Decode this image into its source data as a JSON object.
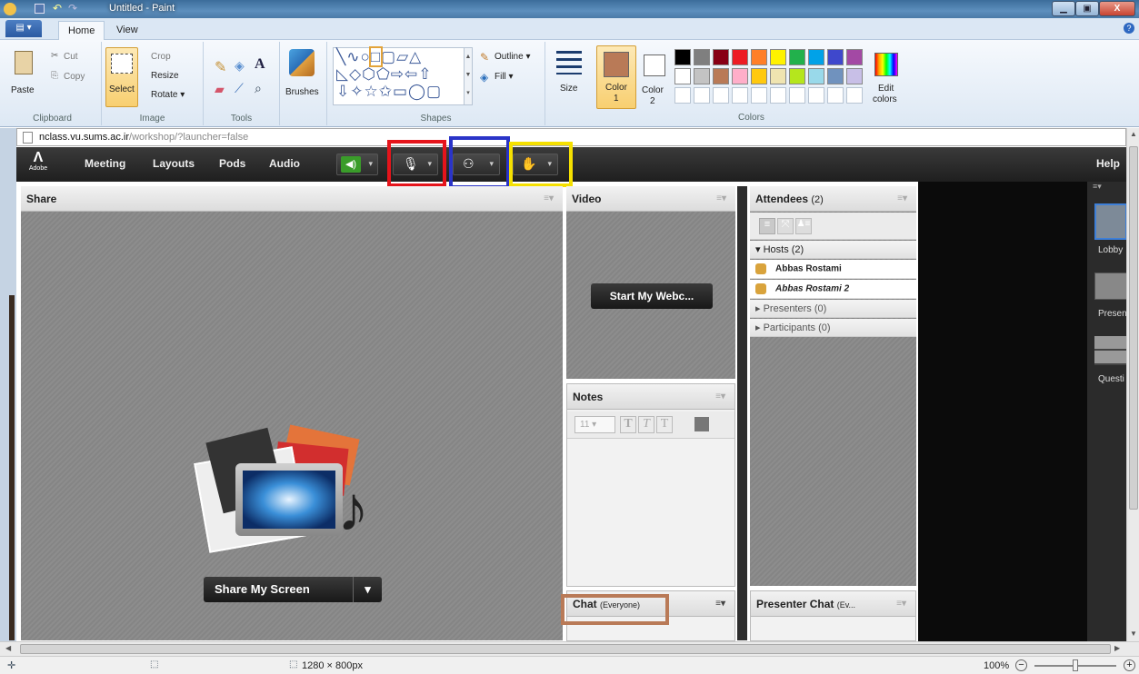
{
  "window": {
    "title": "Untitled - Paint"
  },
  "menu": {
    "home": "Home",
    "view": "View"
  },
  "ribbon": {
    "clipboard": {
      "paste": "Paste",
      "cut": "Cut",
      "copy": "Copy",
      "label": "Clipboard"
    },
    "image": {
      "select": "Select",
      "crop": "Crop",
      "resize": "Resize",
      "rotate": "Rotate ▾",
      "label": "Image"
    },
    "tools": {
      "label": "Tools"
    },
    "brushes": "Brushes",
    "shapes": {
      "outline": "Outline ▾",
      "fill": "Fill ▾",
      "label": "Shapes"
    },
    "size": "Size",
    "color1": "Color\n1",
    "color1_label": "Color",
    "color1_num": "1",
    "color2_label": "Color",
    "color2_num": "2",
    "edit_colors": "Edit",
    "edit_colors2": "colors",
    "colors_label": "Colors",
    "palette_row1": [
      "#000000",
      "#7f7f7f",
      "#880015",
      "#ed1c24",
      "#ff7f27",
      "#fff200",
      "#22b14c",
      "#00a2e8",
      "#3f48cc",
      "#a349a4"
    ],
    "palette_row2": [
      "#ffffff",
      "#c3c3c3",
      "#b97a57",
      "#ffaec9",
      "#ffc90e",
      "#efe4b0",
      "#b5e61d",
      "#99d9ea",
      "#7092be",
      "#c8bfe7"
    ],
    "color1_hex": "#b97a57"
  },
  "address": {
    "domain": "nclass.vu.sums.ac.ir",
    "path": "/workshop/?launcher=false"
  },
  "connect": {
    "logo": "Adobe",
    "menu": [
      "Meeting",
      "Layouts",
      "Pods",
      "Audio"
    ],
    "help": "Help"
  },
  "share": {
    "title": "Share",
    "button": "Share My Screen"
  },
  "video": {
    "title": "Video",
    "button": "Start My Webc..."
  },
  "notes": {
    "title": "Notes",
    "font_size": "11"
  },
  "chat": {
    "title": "Chat",
    "scope": "(Everyone)"
  },
  "attendees": {
    "title": "Attendees",
    "count": "(2)",
    "hosts": "Hosts (2)",
    "host_names": [
      "Abbas Rostami",
      "Abbas Rostami 2"
    ],
    "presenters": "Presenters (0)",
    "participants": "Participants (0)"
  },
  "presenter_chat": {
    "title": "Presenter Chat",
    "scope": "(Ev..."
  },
  "layouts": [
    "Lobby",
    "Presen",
    "Questi"
  ],
  "status": {
    "dimensions": "1280 × 800px",
    "zoom": "100%"
  },
  "highlights": {
    "red": "#e5141b",
    "blue": "#2a34c8",
    "yellow": "#f5e000",
    "brown": "#b97a57"
  }
}
